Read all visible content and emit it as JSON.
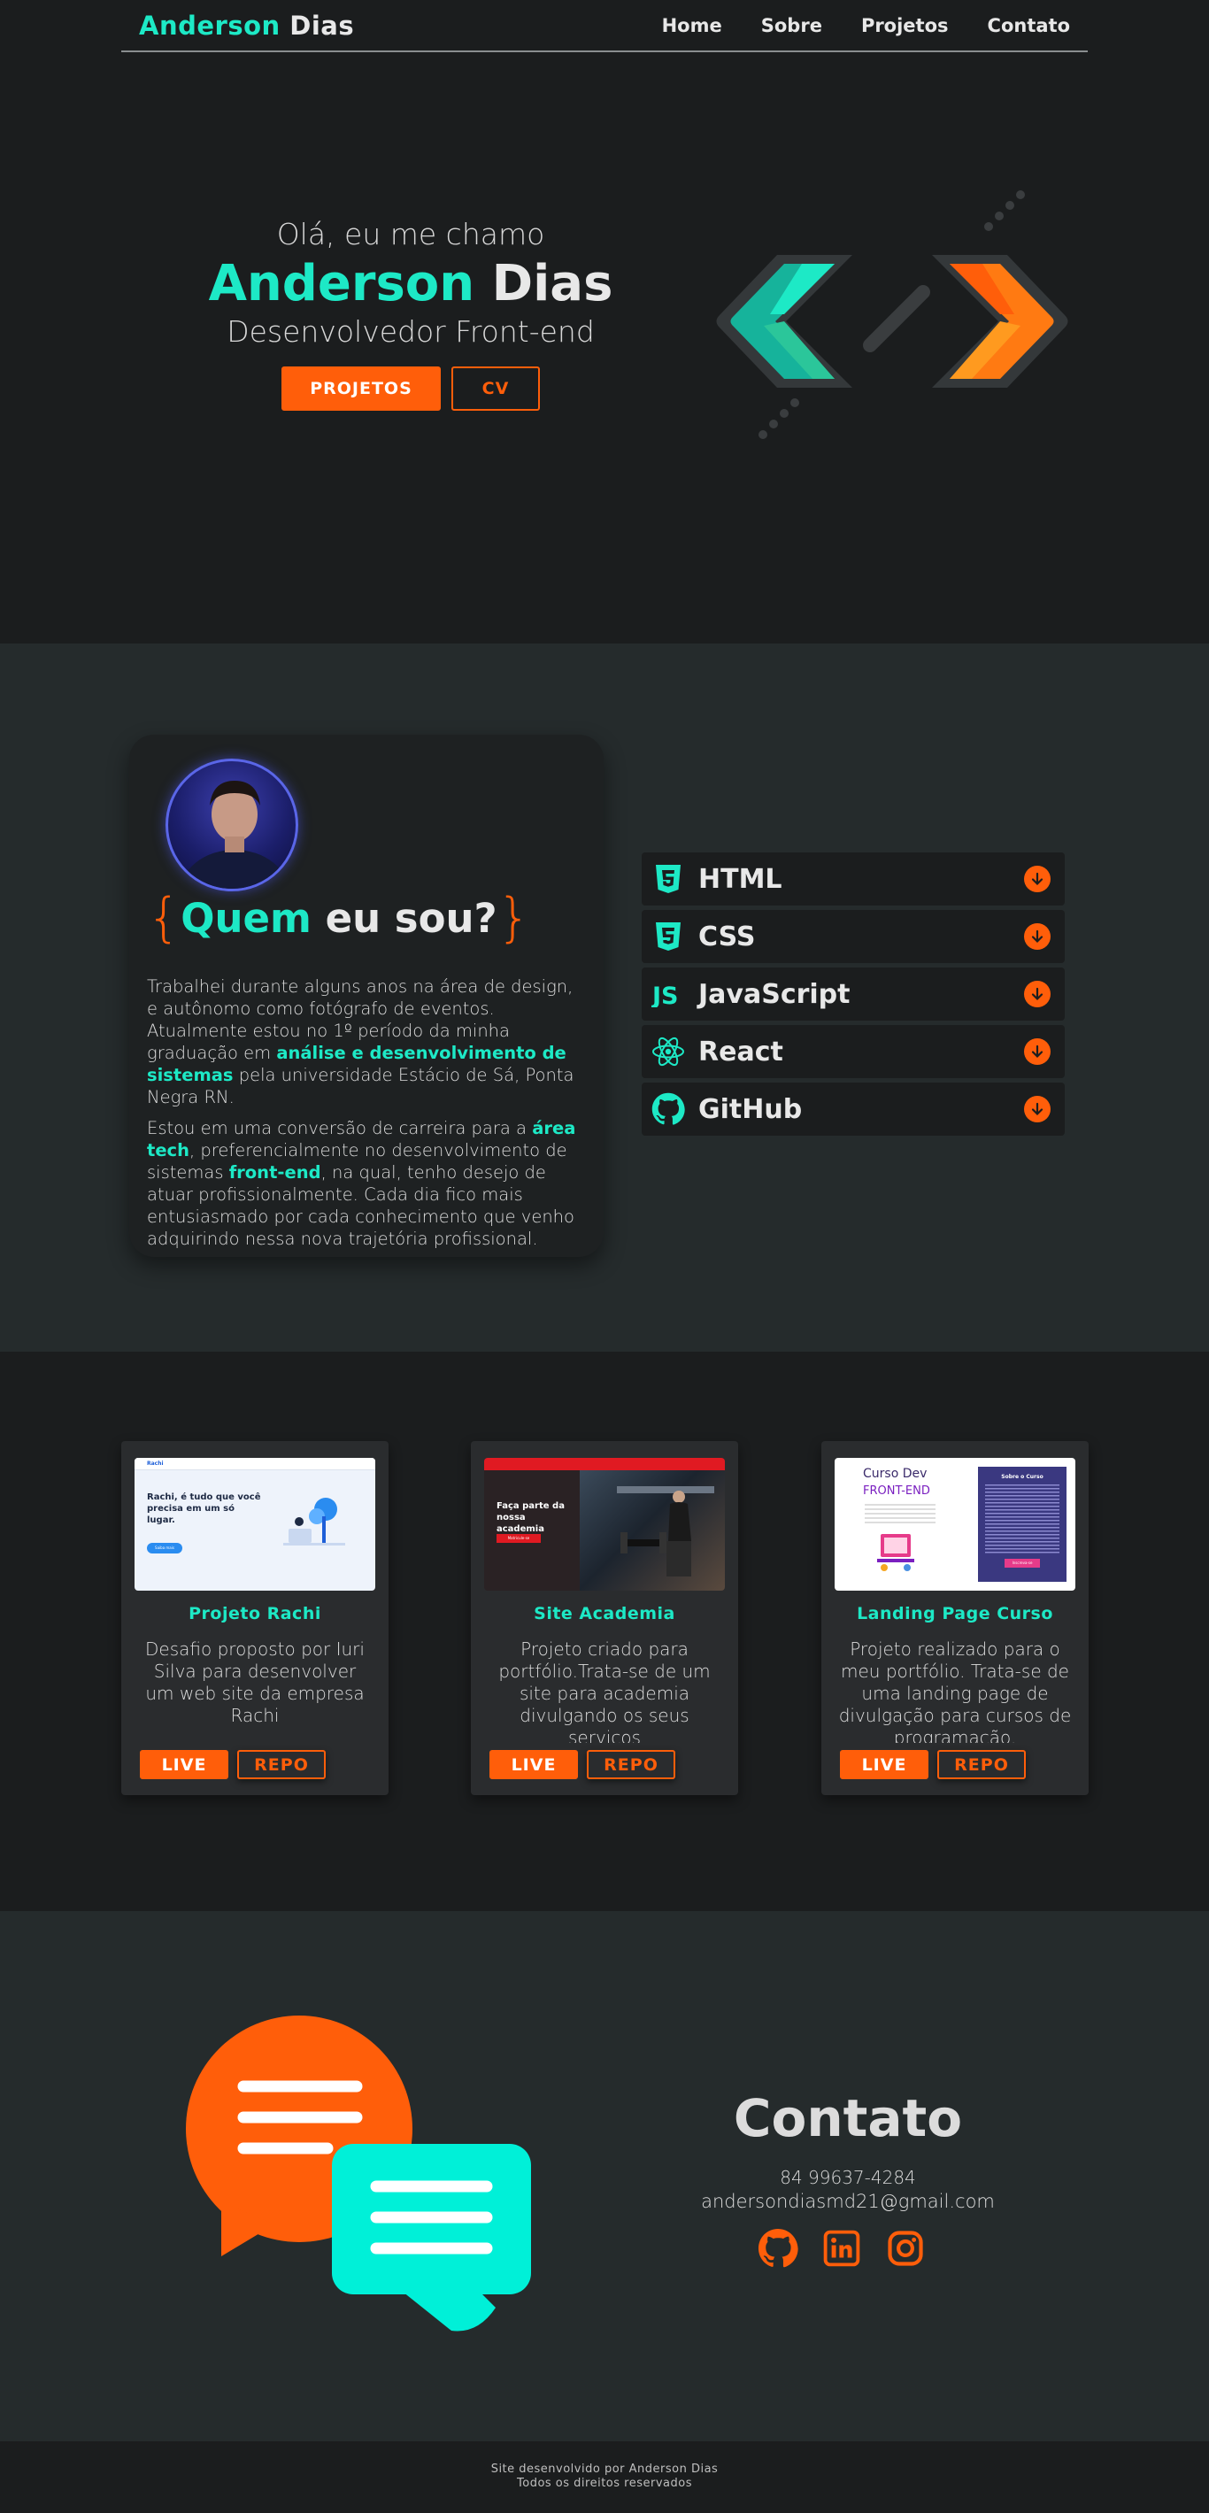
{
  "nav": {
    "brand_first": "Anderson",
    "brand_last": "Dias",
    "links": [
      "Home",
      "Sobre",
      "Projetos",
      "Contato"
    ]
  },
  "hero": {
    "greeting": "Olá, eu me chamo",
    "name_first": "Anderson",
    "name_last": "Dias",
    "role": "Desenvolvedor Front-end",
    "btn_projects": "PROJETOS",
    "btn_cv": "CV"
  },
  "about": {
    "title_q": "Quem",
    "title_rest": "eu sou?",
    "brace_open": "{",
    "brace_close": "}",
    "p1_a": "Trabalhei durante alguns anos na área de design, e autônomo como fotógrafo de eventos. Atualmente estou no 1º período da minha graduação em ",
    "p1_hl": "análise e desenvolvimento de sistemas",
    "p1_b": " pela universidade Estácio de Sá, Ponta Negra RN.",
    "p2_a": "Estou em uma conversão de carreira para a ",
    "p2_hl1": "área tech",
    "p2_b": ", preferencialmente no desenvolvimento de sistemas ",
    "p2_hl2": "front-end",
    "p2_c": ", na qual, tenho desejo de atuar profissionalmente. Cada dia fico mais entusiasmado por cada conhecimento que venho adquirindo nessa nova trajetória profissional."
  },
  "skills": [
    {
      "label": "HTML",
      "icon": "html5-icon"
    },
    {
      "label": "CSS",
      "icon": "css3-icon"
    },
    {
      "label": "JavaScript",
      "icon": "js-icon"
    },
    {
      "label": "React",
      "icon": "react-icon"
    },
    {
      "label": "GitHub",
      "icon": "github-icon"
    }
  ],
  "projects": [
    {
      "title": "Projeto Rachi",
      "desc": "Desafio proposto por Iuri Silva para desenvolver um web site da empresa Rachi",
      "live": "LIVE",
      "repo": "REPO",
      "thumb": {
        "brand": "Rachi",
        "headline": "Rachi, é tudo que você precisa em um só lugar.",
        "cta": "Saiba mais"
      }
    },
    {
      "title": "Site Academia",
      "desc": "Projeto criado para portfólio.Trata-se de um site para academia divulgando os seus serviços",
      "live": "LIVE",
      "repo": "REPO",
      "thumb": {
        "headline": "Faça parte da nossa academia",
        "cta": "Matricule-se"
      }
    },
    {
      "title": "Landing Page Curso",
      "desc": "Projeto realizado para o meu portfólio. Trata-se de uma landing page de divulgação para cursos de programação.",
      "live": "LIVE",
      "repo": "REPO",
      "thumb": {
        "heading1": "Curso Dev",
        "heading2": "FRONT-END",
        "panel_title": "Sobre o Curso",
        "cta": "Inscreva-se"
      }
    }
  ],
  "contact": {
    "title": "Contato",
    "phone": "84 99637-4284",
    "email": "andersondiasmd21@gmail.com",
    "socials": [
      "github-icon",
      "linkedin-icon",
      "instagram-icon"
    ]
  },
  "footer": {
    "line1": "Site desenvolvido por Anderson Dias",
    "line2": "Todos os direitos reservados"
  },
  "colors": {
    "accent": "#1de9c6",
    "orange": "#ff5e0a",
    "bg_dark": "#1b1d1e",
    "bg_mid": "#252b2c"
  }
}
